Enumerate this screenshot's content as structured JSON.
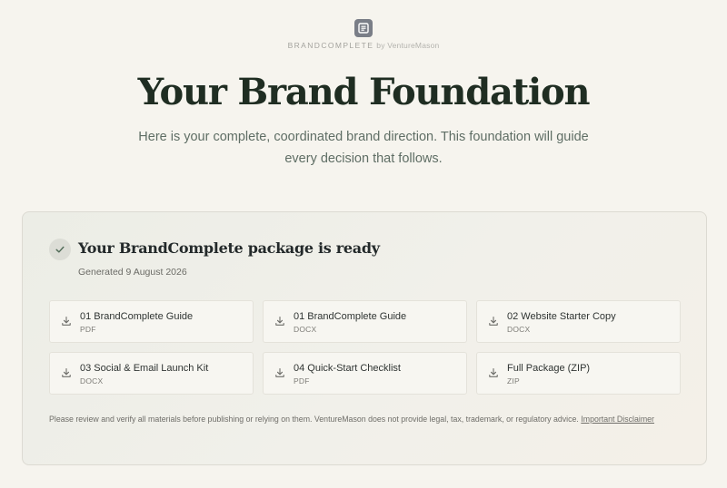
{
  "header": {
    "logo_icon": "document-logo-icon",
    "brand_name": "BRANDCOMPLETE",
    "brand_by": "by VentureMason",
    "title": "Your Brand Foundation",
    "subtitle": "Here is your complete, coordinated brand direction. This foundation will guide every decision that follows."
  },
  "package": {
    "status_icon": "check-icon",
    "title": "Your BrandComplete package is ready",
    "generated": "Generated 9 August 2026",
    "files": [
      {
        "name": "01 BrandComplete Guide",
        "type": "PDF",
        "icon": "download-icon"
      },
      {
        "name": "01 BrandComplete Guide",
        "type": "DOCX",
        "icon": "download-icon"
      },
      {
        "name": "02 Website Starter Copy",
        "type": "DOCX",
        "icon": "download-icon"
      },
      {
        "name": "03 Social & Email Launch Kit",
        "type": "DOCX",
        "icon": "download-icon"
      },
      {
        "name": "04 Quick-Start Checklist",
        "type": "PDF",
        "icon": "download-icon"
      },
      {
        "name": "Full Package (ZIP)",
        "type": "ZIP",
        "icon": "download-icon"
      }
    ],
    "disclaimer_text": "Please review and verify all materials before publishing or relying on them. VentureMason does not provide legal, tax, trademark, or regulatory advice.",
    "disclaimer_link": "Important Disclaimer"
  },
  "colors": {
    "background": "#f6f4ee",
    "title": "#1f2d22",
    "subtitle": "#5f6e65",
    "card_border": "#dcdad2"
  }
}
